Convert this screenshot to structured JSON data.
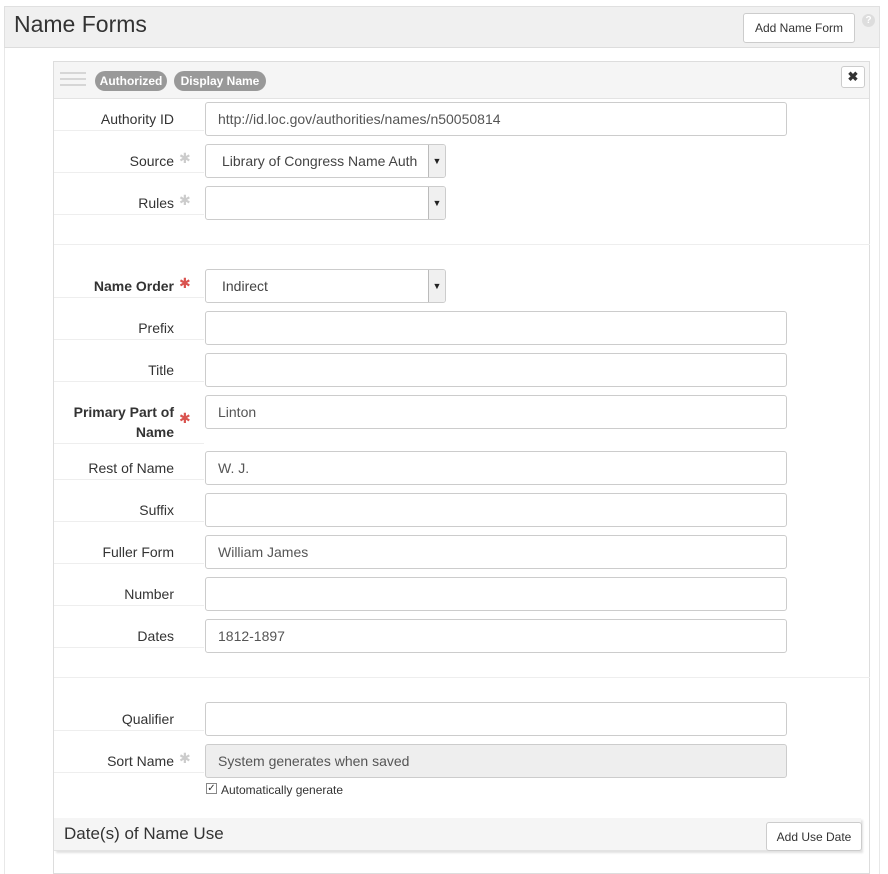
{
  "header": {
    "title": "Name Forms",
    "add_button": "Add Name Form",
    "help_icon": "?"
  },
  "subform": {
    "badges": [
      "Authorized",
      "Display Name"
    ],
    "remove_icon": "✖"
  },
  "fields": {
    "authority_id": {
      "label": "Authority ID",
      "value": "http://id.loc.gov/authorities/names/n50050814"
    },
    "source": {
      "label": "Source",
      "value": "Library of Congress Name Auth"
    },
    "rules": {
      "label": "Rules",
      "value": ""
    },
    "name_order": {
      "label": "Name Order",
      "value": "Indirect"
    },
    "prefix": {
      "label": "Prefix",
      "value": ""
    },
    "title": {
      "label": "Title",
      "value": ""
    },
    "primary_name": {
      "label_line1": "Primary Part of",
      "label_line2": "Name",
      "value": "Linton"
    },
    "rest_of_name": {
      "label": "Rest of Name",
      "value": "W. J."
    },
    "suffix": {
      "label": "Suffix",
      "value": ""
    },
    "fuller_form": {
      "label": "Fuller Form",
      "value": "William James"
    },
    "number": {
      "label": "Number",
      "value": ""
    },
    "dates": {
      "label": "Dates",
      "value": "1812-1897"
    },
    "qualifier": {
      "label": "Qualifier",
      "value": ""
    },
    "sort_name": {
      "label": "Sort Name",
      "value": "System generates when saved"
    }
  },
  "marks": {
    "optional": "✱",
    "required": "✱"
  },
  "auto_generate": {
    "label": "Automatically generate",
    "checked": "✓"
  },
  "use_dates": {
    "title": "Date(s) of Name Use",
    "add_button": "Add Use Date"
  },
  "colors": {
    "required": "#d9534f",
    "pill": "#999999",
    "header_bg": "#f0f0f0"
  }
}
